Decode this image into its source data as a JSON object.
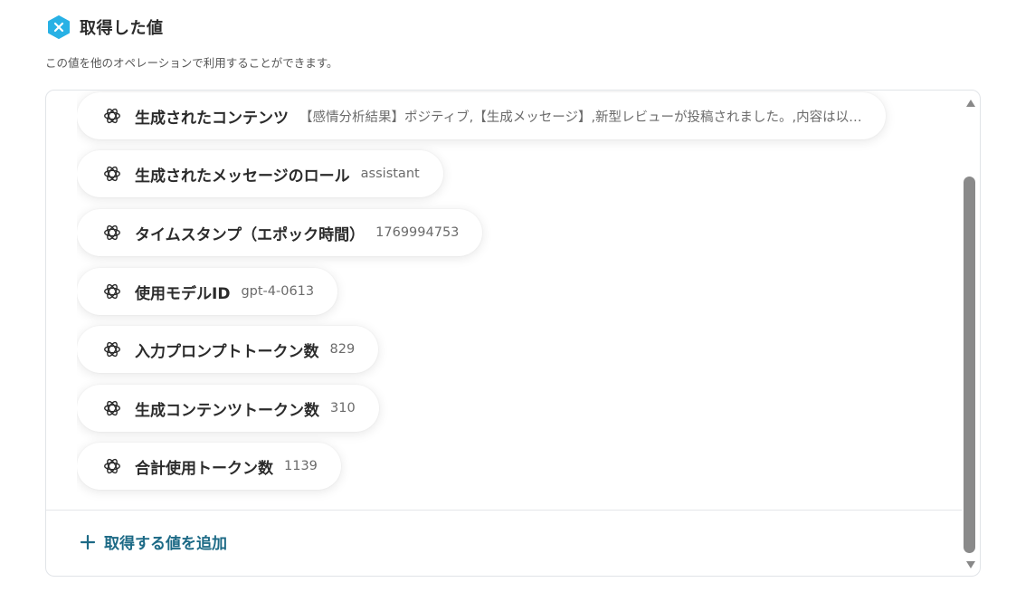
{
  "header": {
    "title": "取得した値",
    "icon": "variable-x-icon",
    "icon_color": "#28b1e5",
    "subtitle": "この値を他のオペレーションで利用することができます。"
  },
  "items": [
    {
      "label": "生成されたコンテンツ",
      "value": "【感情分析結果】ポジティブ,【生成メッセージ】,新型レビューが投稿されました。,内容は以…",
      "icon": "openai-icon"
    },
    {
      "label": "生成されたメッセージのロール",
      "value": "assistant",
      "icon": "openai-icon"
    },
    {
      "label": "タイムスタンプ（エポック時間）",
      "value": "1769994753",
      "icon": "openai-icon"
    },
    {
      "label": "使用モデルID",
      "value": "gpt-4-0613",
      "icon": "openai-icon"
    },
    {
      "label": "入力プロンプトトークン数",
      "value": "829",
      "icon": "openai-icon"
    },
    {
      "label": "生成コンテンツトークン数",
      "value": "310",
      "icon": "openai-icon"
    },
    {
      "label": "合計使用トークン数",
      "value": "1139",
      "icon": "openai-icon"
    }
  ],
  "add_button": {
    "label": "取得する値を追加",
    "icon": "plus-icon",
    "color": "#1d6a86"
  }
}
